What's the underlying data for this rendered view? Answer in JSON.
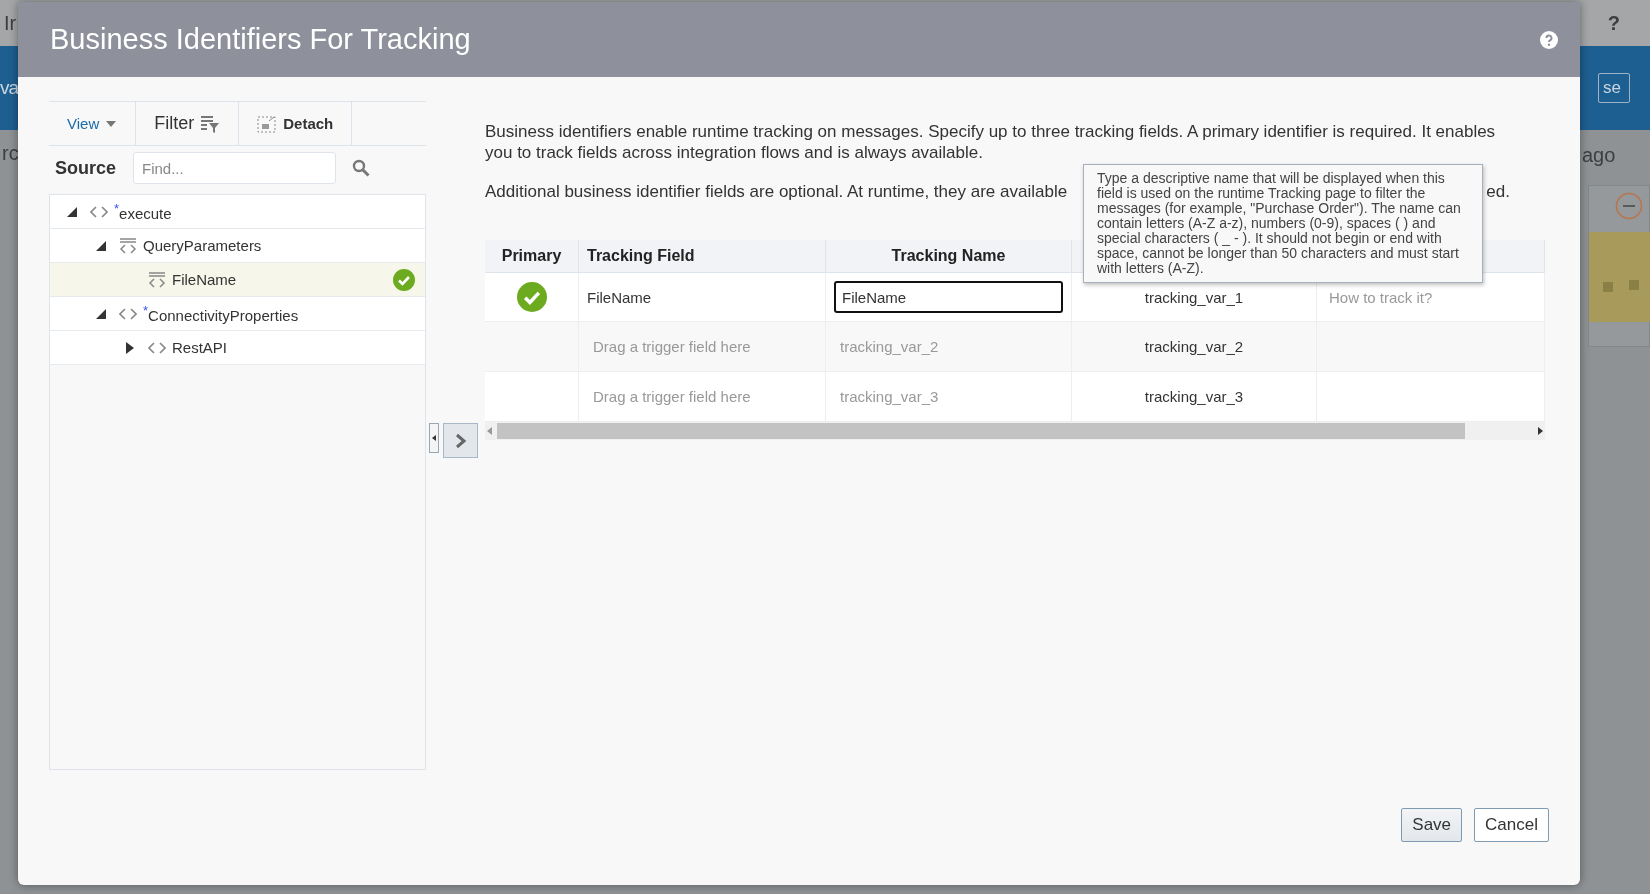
{
  "background": {
    "left_fragments": [
      "Ir",
      "va",
      "rc"
    ],
    "help": "?",
    "button": "se",
    "status": "ago"
  },
  "dialog": {
    "title": "Business Identifiers For Tracking",
    "source_panel": {
      "toolbar": {
        "view": "View",
        "filter": "Filter",
        "detach": "Detach"
      },
      "label": "Source",
      "search": {
        "placeholder": "Find..."
      },
      "tree": [
        {
          "label": "execute",
          "mark": "*",
          "kind": "element",
          "expanded": true,
          "selected": false,
          "mapped": false,
          "children": [
            {
              "label": "QueryParameters",
              "kind": "group",
              "expanded": true,
              "selected": false,
              "mapped": false,
              "children": [
                {
                  "label": "FileName",
                  "kind": "group",
                  "selected": true,
                  "mapped": true
                }
              ]
            },
            {
              "label": "ConnectivityProperties",
              "mark": "*",
              "kind": "element",
              "expanded": true,
              "selected": false,
              "mapped": false,
              "children": [
                {
                  "label": "RestAPI",
                  "kind": "element",
                  "expanded": false,
                  "selected": false,
                  "mapped": false
                }
              ]
            }
          ]
        }
      ]
    },
    "description": [
      {
        "text": "Business identifiers enable runtime tracking on messages. Specify up to three tracking fields. A primary identifier is required. It enables you to track fields across integration flows and is always available."
      },
      {
        "text": "Additional business identifier fields are optional. At runtime, they are available",
        "tail": "ed."
      }
    ],
    "table": {
      "columns": [
        "Primary",
        "Tracking Field",
        "Tracking Name"
      ],
      "rows": [
        {
          "primary": true,
          "tracking_field": {
            "text": "FileName",
            "kind": "value"
          },
          "tracking_name": {
            "text": "FileName",
            "kind": "input"
          },
          "column_4": "tracking_var_1",
          "column_5": {
            "placeholder": "How to track it?"
          }
        },
        {
          "primary": false,
          "tracking_field": {
            "text": "Drag a trigger field here",
            "kind": "placeholder"
          },
          "tracking_name": {
            "text": "tracking_var_2",
            "kind": "placeholder"
          },
          "column_4": "tracking_var_2"
        },
        {
          "primary": false,
          "tracking_field": {
            "text": "Drag a trigger field here",
            "kind": "placeholder"
          },
          "tracking_name": {
            "text": "tracking_var_3",
            "kind": "placeholder"
          },
          "column_4": "tracking_var_3"
        }
      ]
    },
    "tooltip": "Type a descriptive name that will be displayed when this field is used on the runtime Tracking page to filter the messages (for example, \"Purchase Order\"). The name can contain letters (A-Z a-z), numbers (0-9), spaces ( ) and special characters ( _ - ). It should not begin or end with space, cannot be longer than 50 characters and must start with letters (A-Z).",
    "buttons": [
      {
        "label": "Save",
        "kind": "primary"
      },
      {
        "label": "Cancel",
        "kind": "secondary"
      }
    ]
  }
}
